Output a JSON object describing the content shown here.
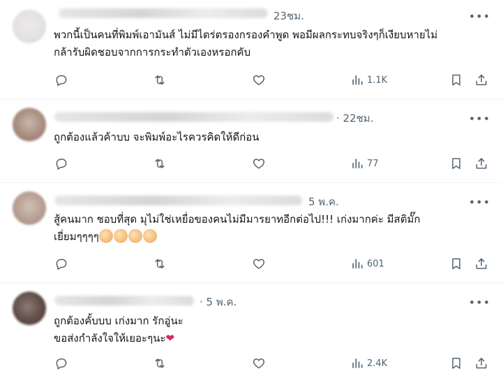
{
  "posts": [
    {
      "time": "23ชม.",
      "lines": [
        "พวกนี้เป็นคนที่พิมพ์เอามันส์ ไม่มีไตร่ตรองกรองคำพูด พอมีผลกระทบจริงๆก็เงียบหายไม่",
        "กล้ารับผิดชอบจากการกระทำตัวเองหรอกคับ"
      ],
      "views": "1.1K"
    },
    {
      "time": "· 22ชม.",
      "lines": [
        "ถูกต้องแล้วค้าบบ จะพิมพ์อะไรควรคิดให้ดีก่อน"
      ],
      "views": "77"
    },
    {
      "time": "5 พ.ค.",
      "lines": [
        "สู้คนมาก ชอบที่สุด มุไม่ใช่เหยื่อของคนไม่มีมารยาทอีกต่อไป!!! เก่งมากค่ะ มีสติมั๊ก",
        "เยี่ยมๆๆๆๆ"
      ],
      "views": "601"
    },
    {
      "time": "· 5 พ.ค.",
      "lines": [
        "ถูกต้องคั้บบบ  เก่งมาก รักอู่นะ",
        "ขอส่งกำลังใจให้เยอะๆนะ"
      ],
      "views": "2.4K"
    }
  ],
  "icons": {
    "reply": "reply-icon",
    "repost": "repost-icon",
    "like": "heart-icon",
    "views": "views-icon",
    "bookmark": "bookmark-icon",
    "share": "share-icon",
    "more": "more-icon"
  },
  "colors": {
    "muted": "#536471",
    "text": "#0f1419",
    "divider": "#eff3f4",
    "heart_emoji": "#e0245e"
  }
}
